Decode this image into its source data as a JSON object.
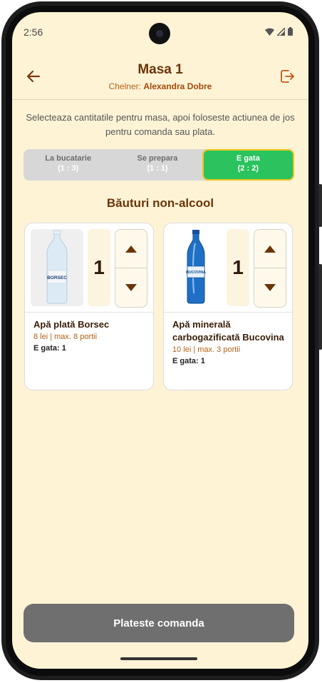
{
  "status_bar": {
    "time": "2:56"
  },
  "header": {
    "title": "Masa 1",
    "waiter_label": "Chelner:",
    "waiter_name": "Alexandra Dobre"
  },
  "instructions": "Selecteaza cantitatile pentru masa, apoi foloseste actiunea de jos pentru comanda sau plata.",
  "tabs": [
    {
      "label": "La bucatarie",
      "count": "(1 : 3)",
      "active": false
    },
    {
      "label": "Se prepara",
      "count": "(1 : 1)",
      "active": false
    },
    {
      "label": "E gata",
      "count": "(2 : 2)",
      "active": true
    }
  ],
  "section_title": "Băuturi non-alcool",
  "products": [
    {
      "name": "Apă plată Borsec",
      "price": "8 lei | max. 8 portii",
      "ready": "E gata: 1",
      "quantity": "1",
      "image_label": "BORSEC"
    },
    {
      "name": "Apă minerală carbogazificată Bucovina",
      "price": "10 lei | max. 3 portii",
      "ready": "E gata: 1",
      "quantity": "1",
      "image_label": "BUCOVINA"
    }
  ],
  "pay_button": "Plateste comanda",
  "colors": {
    "background": "#fff3d6",
    "accent": "#6b3508",
    "active_tab": "#2ac35e",
    "pay_button": "#6f6f6f"
  }
}
